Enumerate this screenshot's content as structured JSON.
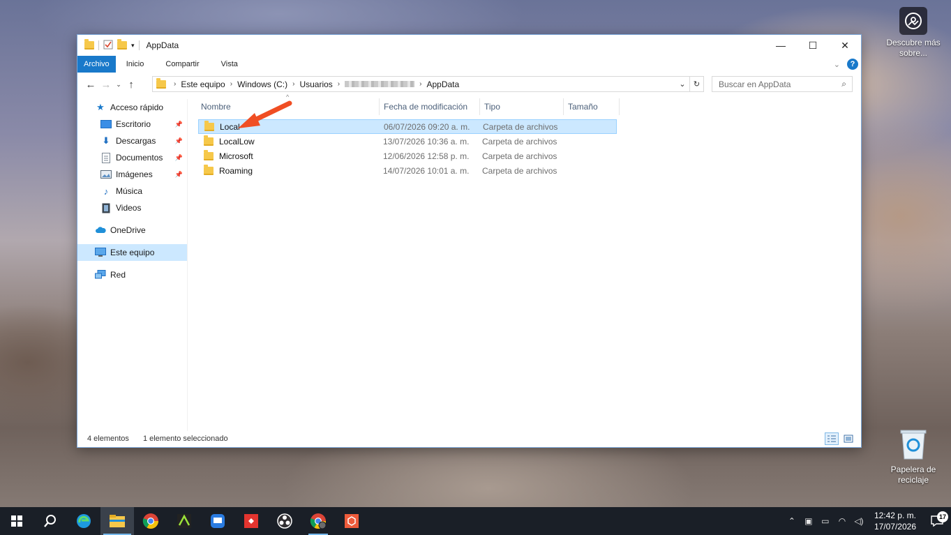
{
  "desktop": {
    "discover_label": "Descubre más sobre...",
    "recycle_label": "Papelera de reciclaje"
  },
  "window": {
    "title": "AppData",
    "ribbon_tabs": [
      "Archivo",
      "Inicio",
      "Compartir",
      "Vista"
    ],
    "breadcrumb": [
      "Este equipo",
      "Windows (C:)",
      "Usuarios",
      "AppData"
    ],
    "search_placeholder": "Buscar en AppData",
    "sidebar": {
      "quick_access": "Acceso rápido",
      "items": [
        "Escritorio",
        "Descargas",
        "Documentos",
        "Imágenes",
        "Música",
        "Videos"
      ],
      "onedrive": "OneDrive",
      "this_pc": "Este equipo",
      "network": "Red"
    },
    "columns": [
      "Nombre",
      "Fecha de modificación",
      "Tipo",
      "Tamaño"
    ],
    "files": [
      {
        "name": "Local",
        "date": "06/07/2026 09:20 a. m.",
        "type": "Carpeta de archivos"
      },
      {
        "name": "LocalLow",
        "date": "13/07/2026 10:36 a. m.",
        "type": "Carpeta de archivos"
      },
      {
        "name": "Microsoft",
        "date": "12/06/2026 12:58 p. m.",
        "type": "Carpeta de archivos"
      },
      {
        "name": "Roaming",
        "date": "14/07/2026 10:01 a. m.",
        "type": "Carpeta de archivos"
      }
    ],
    "status": {
      "count": "4 elementos",
      "selection": "1 elemento seleccionado"
    }
  },
  "taskbar": {
    "time": "12:42 p. m.",
    "date": "17/07/2026",
    "notifications": "17"
  },
  "colors": {
    "accent": "#1979ca",
    "selection": "#cce8ff",
    "annotation_arrow": "#f04e23",
    "taskbar": "#1a1f27"
  }
}
